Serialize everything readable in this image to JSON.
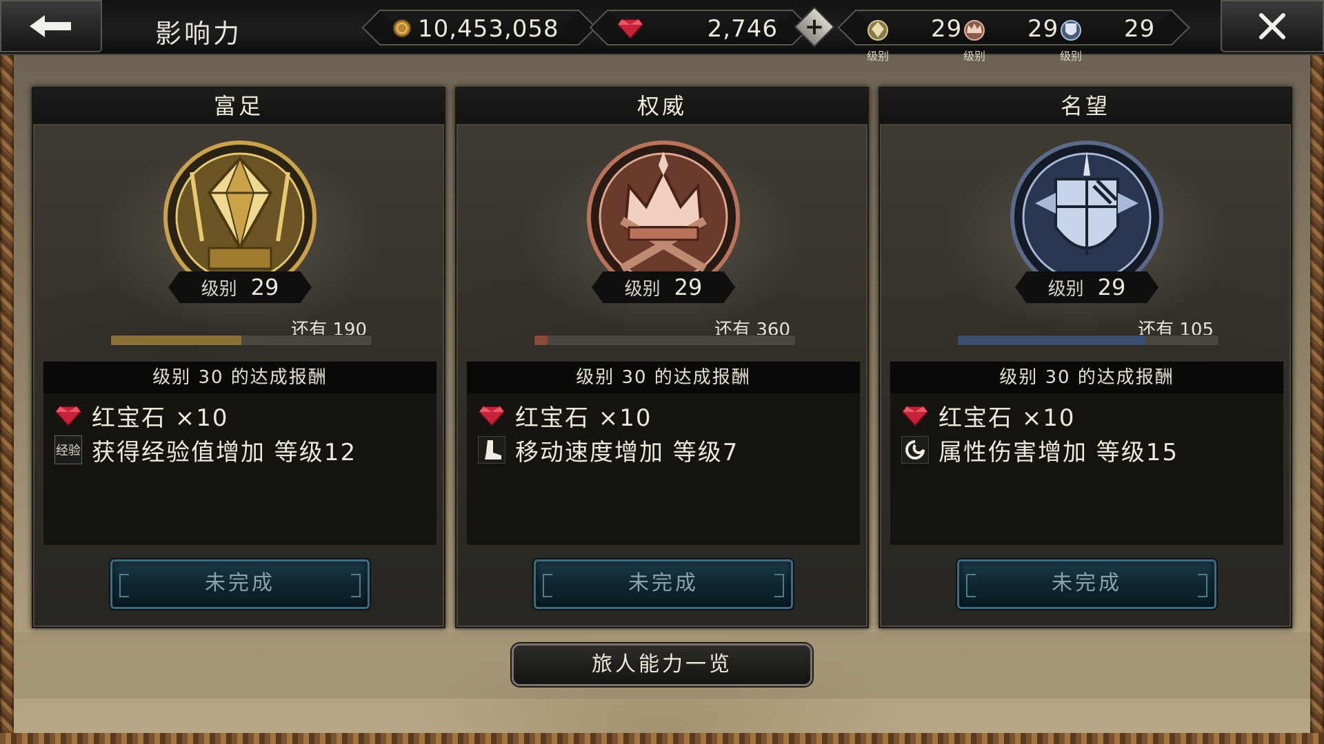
{
  "header": {
    "title": "影响力",
    "gold": "10,453,058",
    "rubies": "2,746",
    "levels": [
      {
        "value": "29",
        "label": "级别",
        "icon": "wealth-crest-icon"
      },
      {
        "value": "29",
        "label": "级别",
        "icon": "power-crest-icon"
      },
      {
        "value": "29",
        "label": "级别",
        "icon": "fame-crest-icon"
      }
    ]
  },
  "cards": [
    {
      "name": "富足",
      "emblem": "wealth-emblem-icon",
      "level_label": "级别",
      "level": "29",
      "remaining": "还有 190",
      "progress": 0.5,
      "bar_color": "#8a7236",
      "reward_title": "级别 30 的达成报酬",
      "reward_items": [
        "红宝石 ×10",
        "获得经验值增加 等级12"
      ],
      "exp_badge": "经验",
      "button": "未完成"
    },
    {
      "name": "权威",
      "emblem": "power-emblem-icon",
      "level_label": "级别",
      "level": "29",
      "remaining": "还有 360",
      "progress": 0.05,
      "bar_color": "#8a4a38",
      "reward_title": "级别 30 的达成报酬",
      "reward_items": [
        "红宝石 ×10",
        "移动速度增加 等级7"
      ],
      "button": "未完成"
    },
    {
      "name": "名望",
      "emblem": "fame-emblem-icon",
      "level_label": "级别",
      "level": "29",
      "remaining": "还有 105",
      "progress": 0.72,
      "bar_color": "#3a4e72",
      "reward_title": "级别 30 的达成报酬",
      "reward_items": [
        "红宝石 ×10",
        "属性伤害增加 等级15"
      ],
      "button": "未完成"
    }
  ],
  "footer": {
    "button": "旅人能力一览"
  },
  "colors": {
    "button_blue": "#1c3a4a",
    "gold": "#c9a24a",
    "ruby": "#c8223a"
  }
}
